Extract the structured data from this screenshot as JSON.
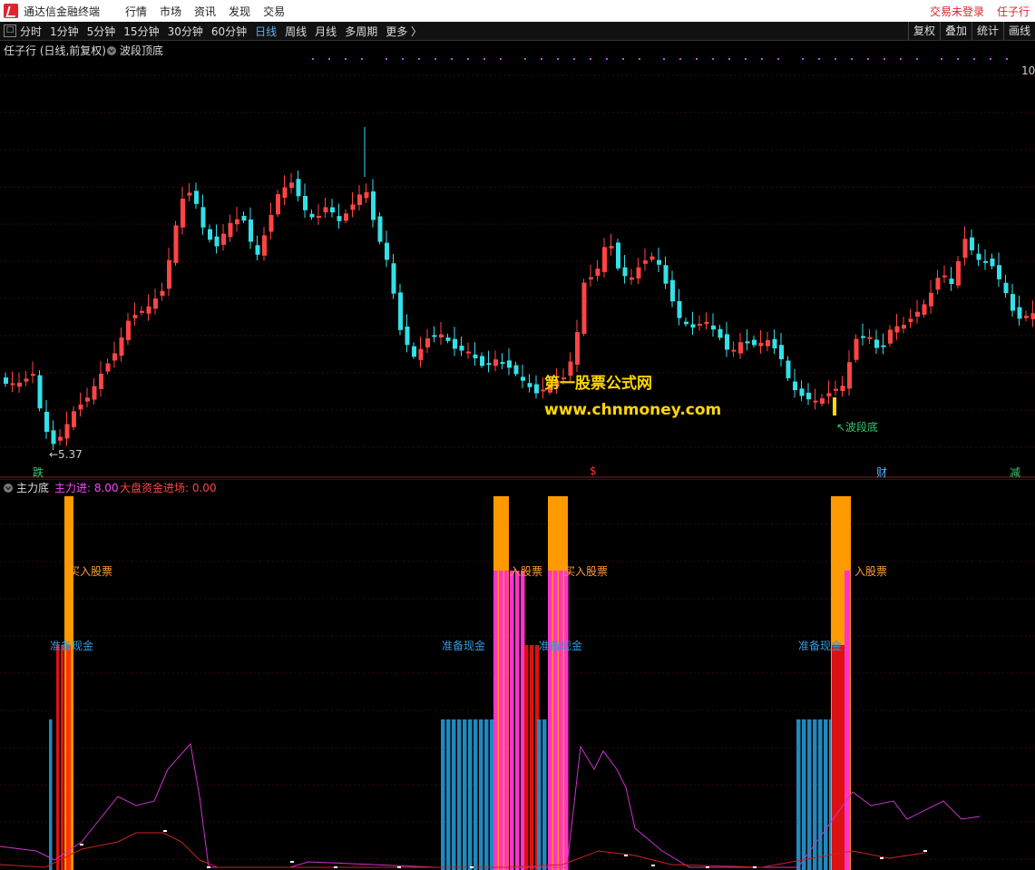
{
  "app": {
    "title": "通达信金融终端"
  },
  "menu": {
    "items": [
      "行情",
      "市场",
      "资讯",
      "发现",
      "交易"
    ],
    "right": [
      "交易未登录",
      "任子行"
    ]
  },
  "toolbar": {
    "periods": [
      "分时",
      "1分钟",
      "5分钟",
      "15分钟",
      "30分钟",
      "60分钟",
      "日线",
      "周线",
      "月线",
      "多周期",
      "更多 〉"
    ],
    "active": "日线",
    "right_buttons": [
      "复权",
      "叠加",
      "统计",
      "画线"
    ]
  },
  "main_chart": {
    "title": "任子行 (日线,前复权)",
    "indicator": "波段顶底",
    "price_right": "10.",
    "low_marker": "←5.37",
    "wave_bottom_label": "↖波段底",
    "watermark_line1": "第一股票公式网",
    "watermark_line2": "www.chnmoney.com",
    "event_markers": [
      "跌",
      "$",
      "财",
      "减"
    ]
  },
  "sub_chart": {
    "title": "主力底",
    "value1": "主力进: 8.00",
    "value2": "大盘资金进场: 0.00",
    "labels": [
      "买入股票",
      "准备现金",
      "入股票",
      "买入股票",
      "准备现金",
      "准备现金",
      "准备现金",
      "入股票"
    ]
  },
  "colors": {
    "up": "#ff4444",
    "down": "#33e0e8",
    "buy": "#ff9900",
    "magenta": "#ff33cc",
    "ready": "#2288bb"
  }
}
